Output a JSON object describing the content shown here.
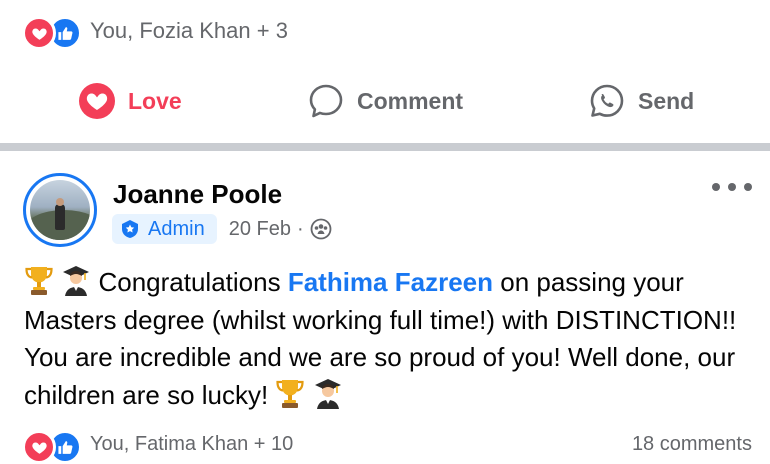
{
  "previous_post": {
    "reactors_text": "You, Fozia Khan + 3",
    "actions": {
      "love_label": "Love",
      "comment_label": "Comment",
      "send_label": "Send"
    }
  },
  "post": {
    "author": "Joanne Poole",
    "badge": "Admin",
    "date": "20 Feb",
    "separator": "·",
    "audience_icon": "group-icon",
    "text": {
      "part1": "Congratulations",
      "mention": "Fathima Fazreen",
      "part2": "on passing your Masters degree (whilst working full time!) with DISTINCTION!! You are incredible and we are so proud of you! Well done, our children are so lucky!"
    },
    "emojis": [
      "trophy-emoji",
      "graduate-emoji"
    ],
    "reactors_text": "You, Fatima Khan + 10",
    "comments_text": "18 comments"
  },
  "colors": {
    "love": "#f33e58",
    "like": "#1877f2",
    "link": "#1877f2",
    "muted": "#65676b",
    "divider": "#c9ccd1"
  }
}
